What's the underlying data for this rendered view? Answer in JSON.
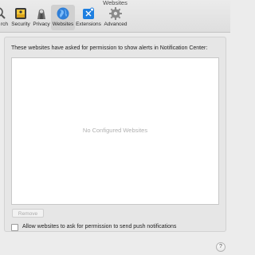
{
  "window": {
    "title": "Websites"
  },
  "toolbar": {
    "items": [
      {
        "label": "Search",
        "visible_label": "rch",
        "icon": "magnifier-icon"
      },
      {
        "label": "Security",
        "icon": "security-icon"
      },
      {
        "label": "Privacy",
        "icon": "privacy-icon"
      },
      {
        "label": "Websites",
        "icon": "globe-icon",
        "selected": true
      },
      {
        "label": "Extensions",
        "icon": "puzzle-icon"
      },
      {
        "label": "Advanced",
        "icon": "gear-icon"
      }
    ]
  },
  "panel": {
    "heading": "These websites have asked for permission to show alerts in Notification Center:",
    "empty_text": "No Configured Websites",
    "remove_label": "Remove",
    "checkbox_label": "Allow websites to ask for permission to send push notifications",
    "checkbox_checked": false,
    "help_label": "?"
  },
  "colors": {
    "selected_tab_bg": "#d0d0d0",
    "globe_blue": "#2f7fd8",
    "extensions_blue": "#1e7fe0"
  }
}
